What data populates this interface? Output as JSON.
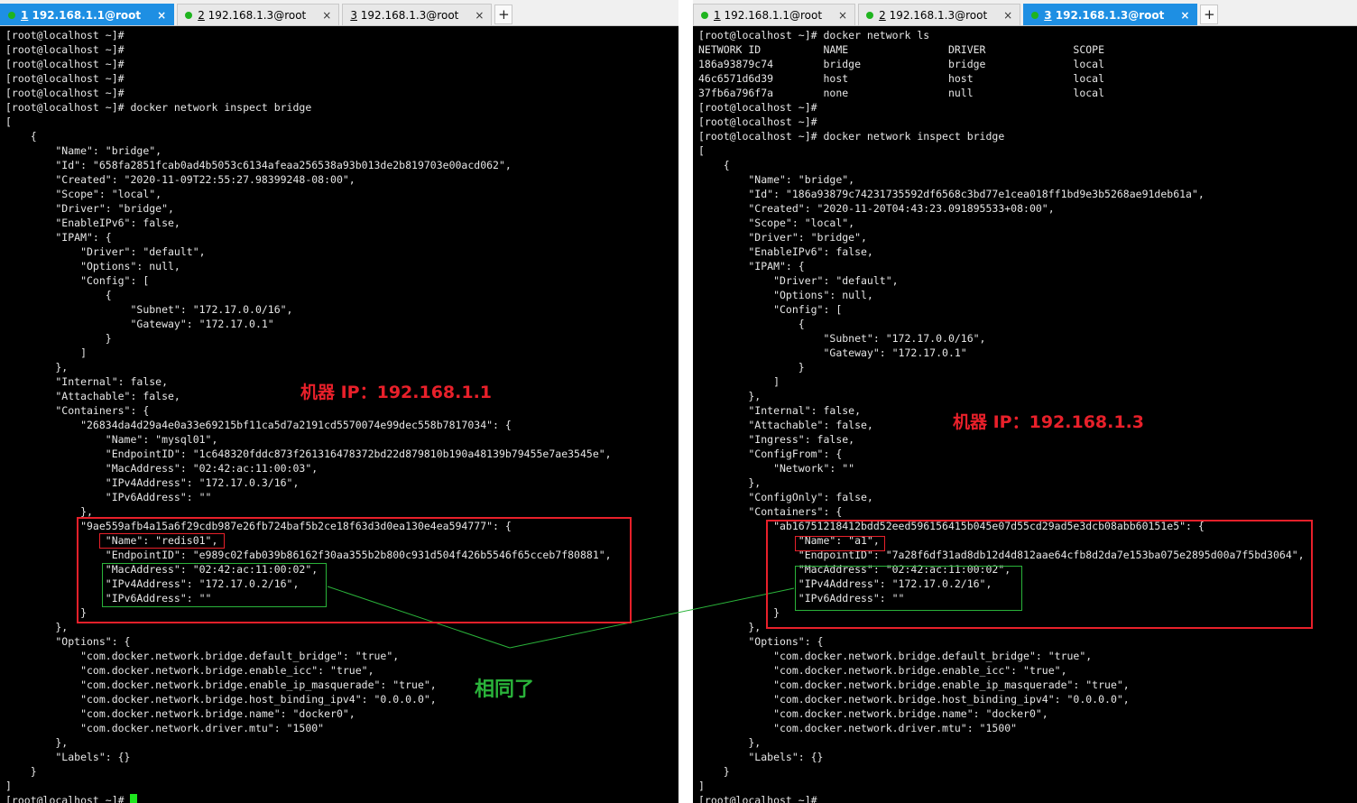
{
  "left": {
    "tabs": [
      {
        "num": "1",
        "label": " 192.168.1.1@root",
        "close": "×",
        "active": true
      },
      {
        "num": "2",
        "label": " 192.168.1.3@root",
        "close": "×",
        "active": false
      },
      {
        "num": "3",
        "label": " 192.168.1.3@root",
        "close": "×",
        "active": false
      }
    ],
    "add_tab": "+",
    "lines": [
      "[root@localhost ~]#",
      "[root@localhost ~]#",
      "[root@localhost ~]#",
      "[root@localhost ~]#",
      "[root@localhost ~]#",
      "[root@localhost ~]# docker network inspect bridge",
      "[",
      "    {",
      "        \"Name\": \"bridge\",",
      "        \"Id\": \"658fa2851fcab0ad4b5053c6134afeaa256538a93b013de2b819703e00acd062\",",
      "        \"Created\": \"2020-11-09T22:55:27.98399248-08:00\",",
      "        \"Scope\": \"local\",",
      "        \"Driver\": \"bridge\",",
      "        \"EnableIPv6\": false,",
      "        \"IPAM\": {",
      "            \"Driver\": \"default\",",
      "            \"Options\": null,",
      "            \"Config\": [",
      "                {",
      "                    \"Subnet\": \"172.17.0.0/16\",",
      "                    \"Gateway\": \"172.17.0.1\"",
      "                }",
      "            ]",
      "        },",
      "        \"Internal\": false,",
      "        \"Attachable\": false,",
      "        \"Containers\": {",
      "            \"26834da4d29a4e0a33e69215bf11ca5d7a2191cd5570074e99dec558b7817034\": {",
      "                \"Name\": \"mysql01\",",
      "                \"EndpointID\": \"1c648320fddc873f261316478372bd22d879810b190a48139b79455e7ae3545e\",",
      "                \"MacAddress\": \"02:42:ac:11:00:03\",",
      "                \"IPv4Address\": \"172.17.0.3/16\",",
      "                \"IPv6Address\": \"\"",
      "            },",
      "            \"9ae559afb4a15a6f29cdb987e26fb724baf5b2ce18f63d3d0ea130e4ea594777\": {",
      "                \"Name\": \"redis01\",",
      "                \"EndpointID\": \"e989c02fab039b86162f30aa355b2b800c931d504f426b5546f65cceb7f80881\",",
      "                \"MacAddress\": \"02:42:ac:11:00:02\",",
      "                \"IPv4Address\": \"172.17.0.2/16\",",
      "                \"IPv6Address\": \"\"",
      "            }",
      "        },",
      "        \"Options\": {",
      "            \"com.docker.network.bridge.default_bridge\": \"true\",",
      "            \"com.docker.network.bridge.enable_icc\": \"true\",",
      "            \"com.docker.network.bridge.enable_ip_masquerade\": \"true\",",
      "            \"com.docker.network.bridge.host_binding_ipv4\": \"0.0.0.0\",",
      "            \"com.docker.network.bridge.name\": \"docker0\",",
      "            \"com.docker.network.driver.mtu\": \"1500\"",
      "        },",
      "        \"Labels\": {}",
      "    }",
      "]"
    ],
    "prompt": "[root@localhost ~]# "
  },
  "right": {
    "tabs": [
      {
        "num": "1",
        "label": " 192.168.1.1@root",
        "close": "×",
        "active": false
      },
      {
        "num": "2",
        "label": " 192.168.1.3@root",
        "close": "×",
        "active": false
      },
      {
        "num": "3",
        "label": " 192.168.1.3@root",
        "close": "×",
        "active": true
      }
    ],
    "add_tab": "+",
    "lines": [
      "[root@localhost ~]# docker network ls",
      "NETWORK ID          NAME                DRIVER              SCOPE",
      "186a93879c74        bridge              bridge              local",
      "46c6571d6d39        host                host                local",
      "37fb6a796f7a        none                null                local",
      "[root@localhost ~]#",
      "[root@localhost ~]#",
      "[root@localhost ~]# docker network inspect bridge",
      "[",
      "    {",
      "        \"Name\": \"bridge\",",
      "        \"Id\": \"186a93879c74231735592df6568c3bd77e1cea018ff1bd9e3b5268ae91deb61a\",",
      "        \"Created\": \"2020-11-20T04:43:23.091895533+08:00\",",
      "        \"Scope\": \"local\",",
      "        \"Driver\": \"bridge\",",
      "        \"EnableIPv6\": false,",
      "        \"IPAM\": {",
      "            \"Driver\": \"default\",",
      "            \"Options\": null,",
      "            \"Config\": [",
      "                {",
      "                    \"Subnet\": \"172.17.0.0/16\",",
      "                    \"Gateway\": \"172.17.0.1\"",
      "                }",
      "            ]",
      "        },",
      "        \"Internal\": false,",
      "        \"Attachable\": false,",
      "        \"Ingress\": false,",
      "        \"ConfigFrom\": {",
      "            \"Network\": \"\"",
      "        },",
      "        \"ConfigOnly\": false,",
      "        \"Containers\": {",
      "            \"ab16751218412bdd52eed596156415b045e07d55cd29ad5e3dcb08abb60151e5\": {",
      "                \"Name\": \"a1\",",
      "                \"EndpointID\": \"7a28f6df31ad8db12d4d812aae64cfb8d2da7e153ba075e2895d00a7f5bd3064\",",
      "                \"MacAddress\": \"02:42:ac:11:00:02\",",
      "                \"IPv4Address\": \"172.17.0.2/16\",",
      "                \"IPv6Address\": \"\"",
      "            }",
      "        },",
      "        \"Options\": {",
      "            \"com.docker.network.bridge.default_bridge\": \"true\",",
      "            \"com.docker.network.bridge.enable_icc\": \"true\",",
      "            \"com.docker.network.bridge.enable_ip_masquerade\": \"true\",",
      "            \"com.docker.network.bridge.host_binding_ipv4\": \"0.0.0.0\",",
      "            \"com.docker.network.bridge.name\": \"docker0\",",
      "            \"com.docker.network.driver.mtu\": \"1500\"",
      "        },",
      "        \"Labels\": {}",
      "    }",
      "]",
      "[root@localhost ~]#"
    ]
  },
  "annotations": {
    "left_ip": "机器 IP：192.168.1.1",
    "right_ip": "机器 IP：192.168.1.3",
    "same": "相同了"
  },
  "colors": {
    "terminal_bg": "#000000",
    "terminal_text": "#e6e6e6",
    "active_tab": "#1e8fe3",
    "status_dot": "#1fb41f",
    "highlight_red": "#e8202a",
    "highlight_green": "#2ab33a",
    "cursor": "#1ee61e"
  }
}
